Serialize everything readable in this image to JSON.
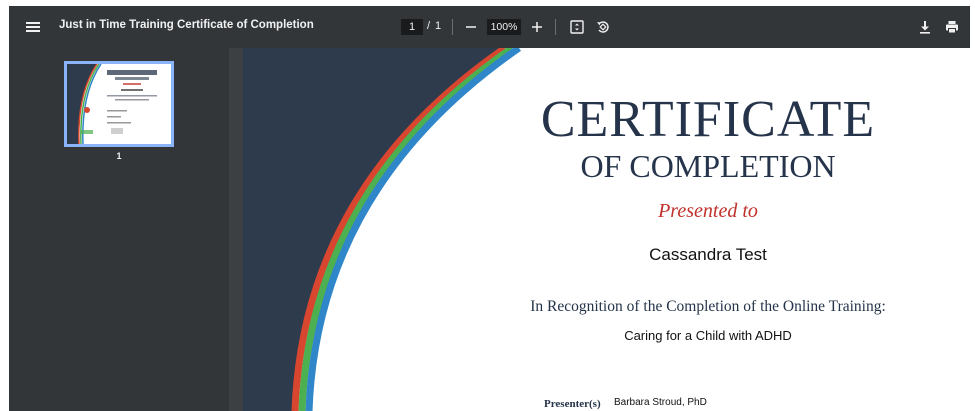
{
  "toolbar": {
    "title": "Just in Time Training Certificate of Completion",
    "page_current": "1",
    "page_separator": "/",
    "page_total": "1",
    "zoom": "100%",
    "icons": {
      "menu": "menu-icon",
      "zoom_out": "minus-icon",
      "zoom_in": "plus-icon",
      "fit": "fit-to-page-icon",
      "rotate": "rotate-icon",
      "download": "download-icon",
      "print": "print-icon"
    }
  },
  "sidebar": {
    "thumbnails": [
      {
        "label": "1",
        "selected": true
      }
    ]
  },
  "certificate": {
    "heading": "CERTIFICATE",
    "subheading": "OF COMPLETION",
    "presented_to": "Presented to",
    "recipient": "Cassandra Test",
    "recognition": "In Recognition of the Completion of the Online Training:",
    "course": "Caring for a Child with ADHD",
    "presenter_label": "Presenter(s)",
    "presenter_name": "Barbara Stroud, PhD"
  },
  "colors": {
    "toolbar_bg": "#323639",
    "viewer_bg": "#525659",
    "page_dark_band": "#2d3b4c",
    "arc_red": "#d9462f",
    "arc_green": "#4caf50",
    "arc_blue": "#2f86c9",
    "title_navy": "#25344a",
    "presented_red": "#c0312b",
    "thumb_border": "#8ab4f8"
  }
}
